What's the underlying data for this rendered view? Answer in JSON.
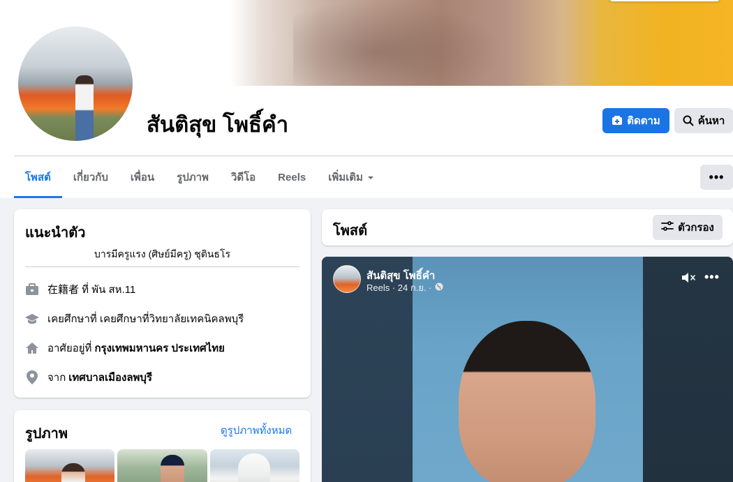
{
  "profile": {
    "name": "สันติสุข โพธิ์คำ",
    "follow_label": "ติดตาม",
    "search_label": "ค้นหา"
  },
  "tabs": [
    {
      "label": "โพสต์",
      "active": true
    },
    {
      "label": "เกี่ยวกับ",
      "active": false
    },
    {
      "label": "เพื่อน",
      "active": false
    },
    {
      "label": "รูปภาพ",
      "active": false
    },
    {
      "label": "วิดีโอ",
      "active": false
    },
    {
      "label": "Reels",
      "active": false
    },
    {
      "label": "เพิ่มเติม",
      "active": false
    }
  ],
  "more_label": "•••",
  "intro": {
    "title": "แนะนำตัว",
    "bio": "บารมีครูแรง (ศิษย์มีครู) ชุตินธโร",
    "items": [
      {
        "icon": "briefcase-icon",
        "prefix": "在籍者 ที่ พัน สห.11",
        "bold": ""
      },
      {
        "icon": "graduation-cap-icon",
        "prefix": "เคยศึกษาที่ เคยศึกษาที่วิทยาลัยเทคนิคลพบุรี",
        "bold": ""
      },
      {
        "icon": "home-icon",
        "prefix": "อาศัยอยู่ที่",
        "bold": "กรุงเทพมหานคร ประเทศไทย"
      },
      {
        "icon": "location-pin-icon",
        "prefix": "จาก",
        "bold": "เทศบาลเมืองลพบุรี"
      }
    ]
  },
  "photos": {
    "title": "รูปภาพ",
    "see_all": "ดูรูปภาพทั้งหมด"
  },
  "posts": {
    "title": "โพสต์",
    "filter_label": "ตัวกรอง"
  },
  "reel": {
    "author": "สันติสุข โพธิ์คำ",
    "meta": "Reels · 24 ก.ย. ·",
    "more": "•••"
  },
  "colors": {
    "accent": "#1877f2",
    "follow_button": "#1b74e4",
    "secondary_button": "#e4e6eb",
    "page_bg": "#f0f2f5"
  }
}
